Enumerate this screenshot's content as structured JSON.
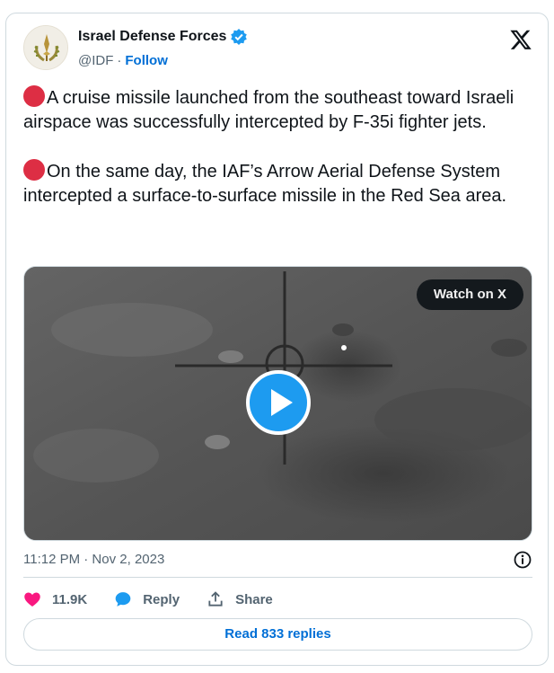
{
  "author": {
    "name": "Israel Defense Forces",
    "handle": "@IDF",
    "separator": "·",
    "follow_label": "Follow",
    "verified_color": "#1d9bf0"
  },
  "tweet": {
    "paragraphs": [
      "A cruise missile launched from the southeast toward Israeli airspace was successfully intercepted by F-35i fighter jets.",
      "On the same day, the IAF’s Arrow Aerial Defense System intercepted a surface-to-surface missile in the Red Sea area."
    ],
    "emoji_color": "#dd2e44"
  },
  "media": {
    "watch_label": "Watch on X",
    "play_color": "#1d9bf0"
  },
  "timestamp": "11:12 PM · Nov 2, 2023",
  "actions": {
    "likes": "11.9K",
    "reply_label": "Reply",
    "share_label": "Share",
    "like_color": "#f91880",
    "reply_color": "#1d9bf0"
  },
  "read_replies_label": "Read 833 replies",
  "icons": [
    "idf-emblem-icon",
    "verified-badge-icon",
    "x-logo-icon",
    "play-icon",
    "info-icon",
    "heart-icon",
    "reply-bubble-icon",
    "share-icon"
  ]
}
